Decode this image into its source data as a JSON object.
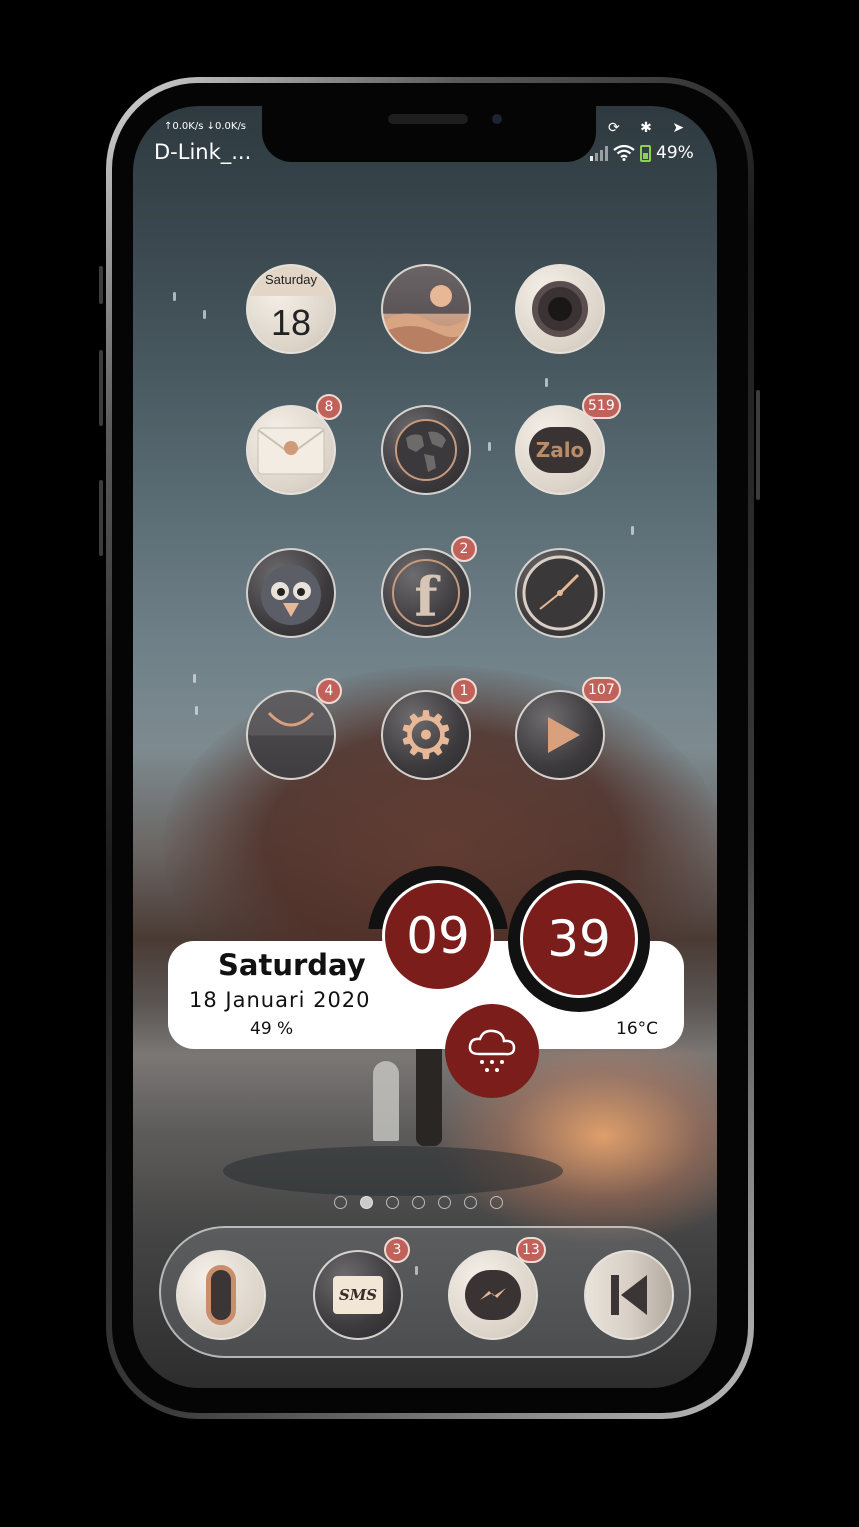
{
  "status_bar": {
    "speed": "↑0.0K/s ↓0.0K/s",
    "carrier": "D-Link_...",
    "icons_top": "⟳ ✱ ➤",
    "battery": "49%"
  },
  "apps": [
    {
      "name": "calendar",
      "header": "Saturday",
      "day": "18"
    },
    {
      "name": "photos"
    },
    {
      "name": "camera"
    },
    {
      "name": "mail",
      "badge": "8"
    },
    {
      "name": "maps"
    },
    {
      "name": "zalo",
      "label": "Zalo",
      "badge": "519"
    },
    {
      "name": "tweetbot"
    },
    {
      "name": "facebook",
      "badge": "2"
    },
    {
      "name": "clock"
    },
    {
      "name": "app-store",
      "badge": "4"
    },
    {
      "name": "settings",
      "badge": "1"
    },
    {
      "name": "play-store",
      "badge": "107"
    }
  ],
  "widget": {
    "day": "Saturday",
    "date": "18 Januari 2020",
    "battery": "49 %",
    "hour": "09",
    "minute": "39",
    "temperature": "16°C"
  },
  "pages": {
    "count": 7,
    "active": 1
  },
  "dock": [
    {
      "name": "phone"
    },
    {
      "name": "sms",
      "label": "SMS",
      "badge": "3"
    },
    {
      "name": "messenger",
      "badge": "13"
    },
    {
      "name": "music"
    }
  ],
  "colors": {
    "accent": "#7b1d1b",
    "badge": "#c0615a",
    "rose_gold": "#d9a07e"
  }
}
